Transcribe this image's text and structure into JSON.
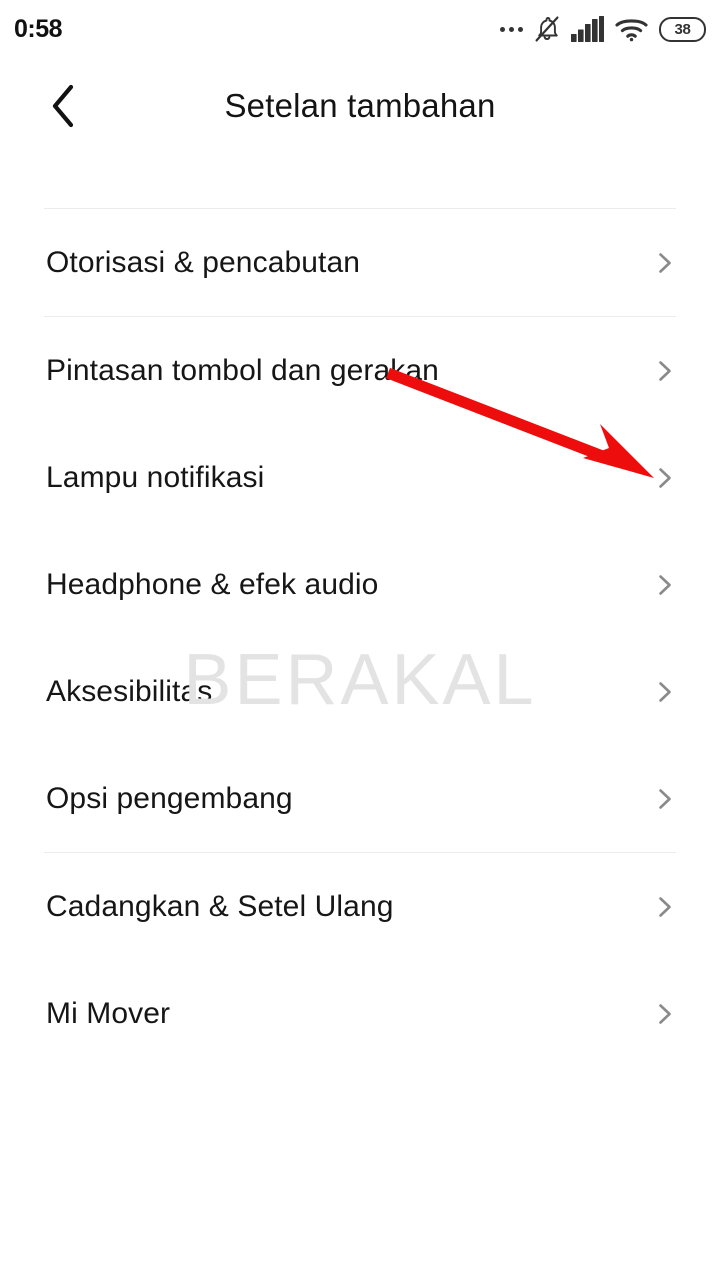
{
  "status_bar": {
    "clock": "0:58",
    "battery_level": "38",
    "icons": [
      "more-dots-icon",
      "bell-muted-icon",
      "signal-bars-icon",
      "wifi-icon",
      "battery-icon"
    ]
  },
  "app_bar": {
    "back_icon": "chevron-left-icon",
    "title": "Setelan tambahan"
  },
  "settings_list": {
    "groups": [
      {
        "items": [
          {
            "label": "Otorisasi & pencabutan",
            "chevron": "chevron-right-icon"
          }
        ]
      },
      {
        "items": [
          {
            "label": "Pintasan tombol dan gerakan",
            "chevron": "chevron-right-icon"
          },
          {
            "label": "Lampu notifikasi",
            "chevron": "chevron-right-icon"
          },
          {
            "label": "Headphone & efek audio",
            "chevron": "chevron-right-icon"
          },
          {
            "label": "Aksesibilitas",
            "chevron": "chevron-right-icon"
          },
          {
            "label": "Opsi pengembang",
            "chevron": "chevron-right-icon"
          }
        ]
      },
      {
        "items": [
          {
            "label": "Cadangkan & Setel Ulang",
            "chevron": "chevron-right-icon"
          },
          {
            "label": "Mi Mover",
            "chevron": "chevron-right-icon"
          }
        ]
      }
    ]
  },
  "watermark": {
    "text": "BERAKAL"
  },
  "annotation": {
    "type": "arrow",
    "color": "#ee0d0d",
    "points_to": "Pintasan tombol dan gerakan"
  },
  "colors": {
    "background": "#ffffff",
    "text_primary": "#161616",
    "chevron": "#8a8a8a",
    "divider": "#ececec",
    "watermark": "#e3e3e3",
    "annotation_red": "#ee0d0d"
  }
}
